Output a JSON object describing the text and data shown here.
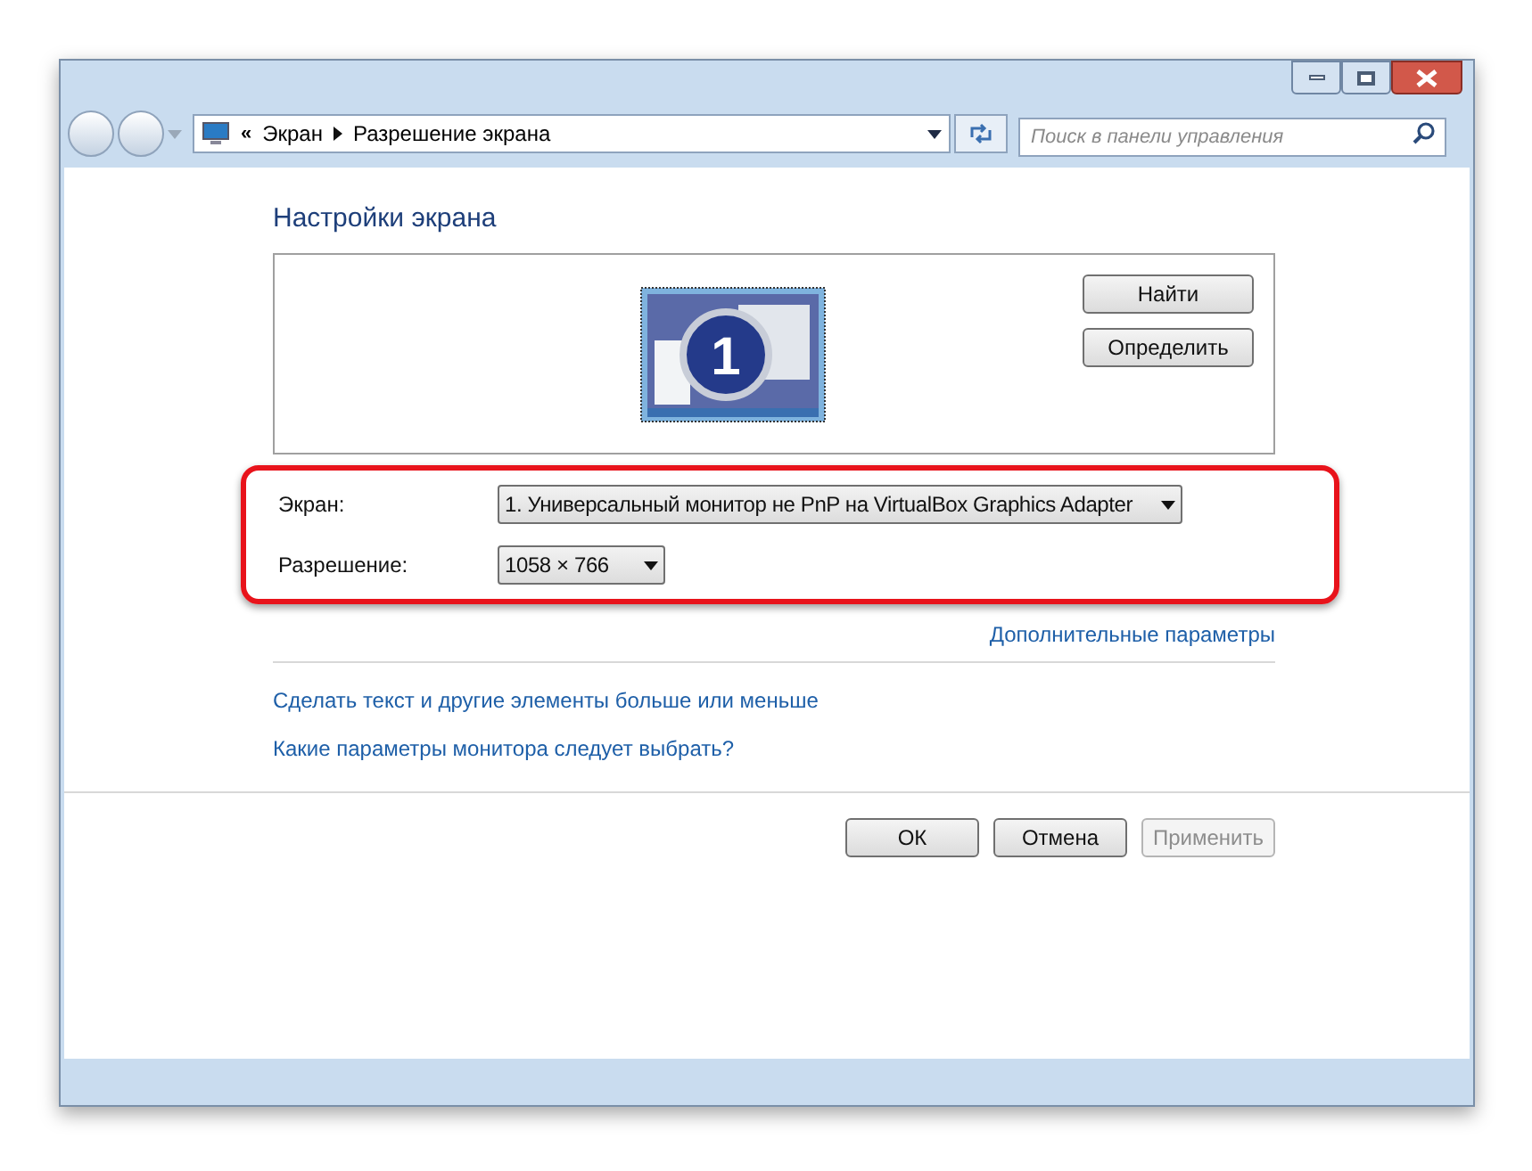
{
  "address_bar": {
    "overflow": "«",
    "breadcrumbs": [
      "Экран",
      "Разрешение экрана"
    ]
  },
  "search": {
    "placeholder": "Поиск в панели управления"
  },
  "heading": "Настройки экрана",
  "display_buttons": [
    {
      "label": "Найти"
    },
    {
      "label": "Определить"
    }
  ],
  "monitor_number": "1",
  "settings": {
    "highlighted": true,
    "fields": [
      {
        "label": "Экран:",
        "value": "1. Универсальный монитор не PnP на VirtualBox Graphics Adapter"
      },
      {
        "label": "Разрешение:",
        "value": "1058 × 766"
      }
    ]
  },
  "advanced_link": "Дополнительные параметры",
  "links": [
    "Сделать текст и другие элементы больше или меньше",
    "Какие параметры монитора следует выбрать?"
  ],
  "buttons": [
    {
      "label": "ОК",
      "disabled": false
    },
    {
      "label": "Отмена",
      "disabled": false
    },
    {
      "label": "Применить",
      "disabled": true
    }
  ]
}
